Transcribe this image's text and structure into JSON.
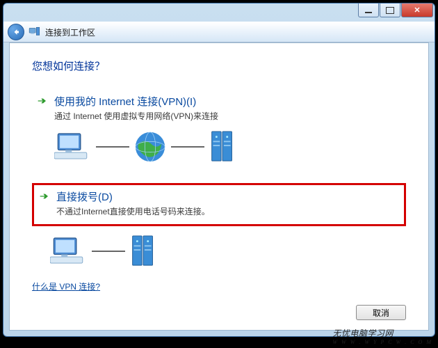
{
  "window": {
    "nav_title": "连接到工作区",
    "buttons": {
      "close_label": "✕"
    }
  },
  "content": {
    "heading": "您想如何连接？",
    "options": [
      {
        "title": "使用我的 Internet 连接(VPN)(I)",
        "desc": "通过 Internet 使用虚拟专用网络(VPN)来连接",
        "highlighted": false,
        "illustration": "vpn"
      },
      {
        "title": "直接拨号(D)",
        "desc": "不通过Internet直接使用电话号码来连接。",
        "highlighted": true,
        "illustration": "dial"
      }
    ],
    "help_link": "什么是 VPN 连接?",
    "cancel_label": "取消"
  },
  "watermark": {
    "line1": "无忧电脑学习网",
    "line2": "W W W . W Y P C W . C O M"
  }
}
